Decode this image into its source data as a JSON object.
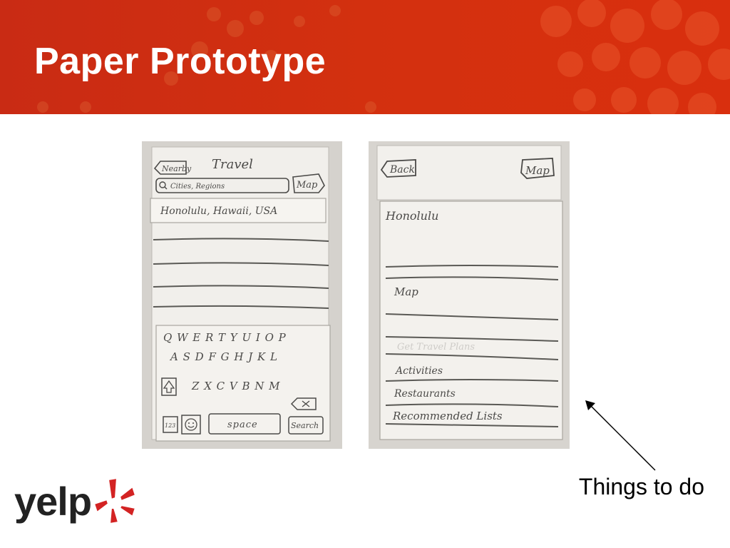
{
  "slide": {
    "title": "Paper Prototype",
    "annotation": "Things to do"
  },
  "colors": {
    "banner": "#d3300f",
    "title_text": "#ffffff",
    "paper": "#f3f1ed",
    "pencil": "#4b4a48",
    "logo_burst": "#d32323"
  },
  "prototype_left": {
    "top_bar": {
      "back_label": "Nearby",
      "title": "Travel",
      "search_placeholder": "Cities, Regions",
      "map_label": "Map"
    },
    "suggestion": "Honolulu, Hawaii, USA",
    "keyboard": {
      "row1": "Q W E R T Y U I O P",
      "row2": "A S D F G H J K L",
      "row3": "Z X C V B N M",
      "numbers_key": "123",
      "space_key": "space",
      "search_key": "Search",
      "shift_icon": "shift-arrow-icon",
      "delete_icon": "backspace-icon",
      "emoji_icon": "smiley-icon"
    }
  },
  "prototype_right": {
    "top_bar": {
      "back_label": "Back",
      "map_label": "Map"
    },
    "city": "Honolulu",
    "map_label": "Map",
    "erased_item": "Get Travel Plans",
    "list": [
      "Activities",
      "Restaurants",
      "Recommended Lists"
    ]
  },
  "logo": {
    "text": "yelp",
    "icon": "yelp-burst-icon"
  }
}
